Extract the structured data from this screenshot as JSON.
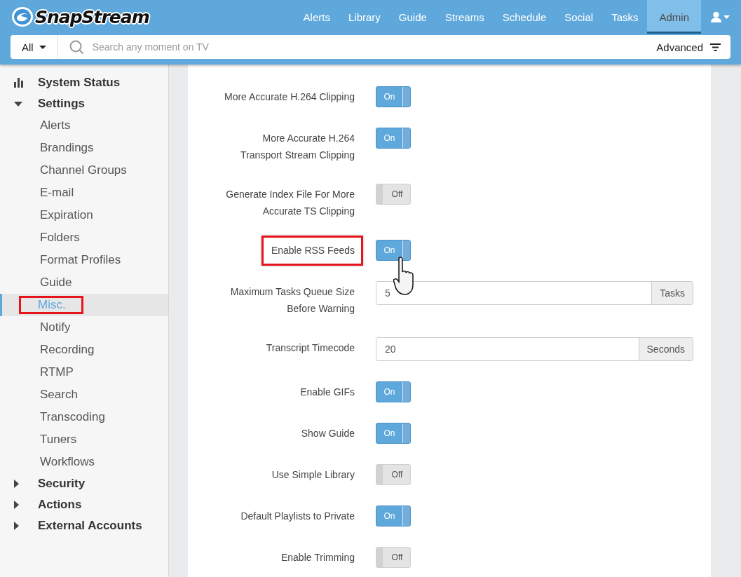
{
  "header": {
    "logo": "SnapStream",
    "nav": [
      {
        "label": "Alerts",
        "selected": false
      },
      {
        "label": "Library",
        "selected": false
      },
      {
        "label": "Guide",
        "selected": false
      },
      {
        "label": "Streams",
        "selected": false
      },
      {
        "label": "Schedule",
        "selected": false
      },
      {
        "label": "Social",
        "selected": false
      },
      {
        "label": "Tasks",
        "selected": false
      },
      {
        "label": "Admin",
        "selected": true
      }
    ]
  },
  "search": {
    "scope": "All",
    "placeholder": "Search any moment on TV",
    "advanced": "Advanced"
  },
  "sidebar": {
    "items": [
      {
        "label": "System Status",
        "kind": "page"
      },
      {
        "label": "Settings",
        "kind": "group",
        "expanded": true,
        "children": [
          {
            "label": "Alerts",
            "selected": false,
            "highlighted": false
          },
          {
            "label": "Brandings",
            "selected": false,
            "highlighted": false
          },
          {
            "label": "Channel Groups",
            "selected": false,
            "highlighted": false
          },
          {
            "label": "E-mail",
            "selected": false,
            "highlighted": false
          },
          {
            "label": "Expiration",
            "selected": false,
            "highlighted": false
          },
          {
            "label": "Folders",
            "selected": false,
            "highlighted": false
          },
          {
            "label": "Format Profiles",
            "selected": false,
            "highlighted": false
          },
          {
            "label": "Guide",
            "selected": false,
            "highlighted": false
          },
          {
            "label": "Misc.",
            "selected": true,
            "highlighted": true
          },
          {
            "label": "Notify",
            "selected": false,
            "highlighted": false
          },
          {
            "label": "Recording",
            "selected": false,
            "highlighted": false
          },
          {
            "label": "RTMP",
            "selected": false,
            "highlighted": false
          },
          {
            "label": "Search",
            "selected": false,
            "highlighted": false
          },
          {
            "label": "Transcoding",
            "selected": false,
            "highlighted": false
          },
          {
            "label": "Tuners",
            "selected": false,
            "highlighted": false
          },
          {
            "label": "Workflows",
            "selected": false,
            "highlighted": false
          }
        ]
      },
      {
        "label": "Security",
        "kind": "group",
        "expanded": false
      },
      {
        "label": "Actions",
        "kind": "group",
        "expanded": false
      },
      {
        "label": "External Accounts",
        "kind": "group",
        "expanded": false
      }
    ]
  },
  "settings": {
    "rows": [
      {
        "kind": "toggle",
        "label": "More Accurate H.264 Clipping",
        "on": true,
        "text": "On",
        "highlighted": false
      },
      {
        "kind": "toggle",
        "label": "More Accurate H.264\nTransport Stream Clipping",
        "on": true,
        "text": "On",
        "highlighted": false
      },
      {
        "kind": "toggle",
        "label": "Generate Index File For More\nAccurate TS Clipping",
        "on": false,
        "text": "Off",
        "highlighted": false
      },
      {
        "kind": "toggle",
        "label": "Enable RSS Feeds",
        "on": true,
        "text": "On",
        "highlighted": true
      },
      {
        "kind": "field",
        "label": "Maximum Tasks Queue Size\nBefore Warning",
        "value": "5",
        "addon": "Tasks",
        "highlighted": false
      },
      {
        "kind": "field",
        "label": "Transcript Timecode",
        "value": "20",
        "addon": "Seconds",
        "highlighted": false
      },
      {
        "kind": "toggle",
        "label": "Enable GIFs",
        "on": true,
        "text": "On",
        "highlighted": false
      },
      {
        "kind": "toggle",
        "label": "Show Guide",
        "on": true,
        "text": "On",
        "highlighted": false
      },
      {
        "kind": "toggle",
        "label": "Use Simple Library",
        "on": false,
        "text": "Off",
        "highlighted": false
      },
      {
        "kind": "toggle",
        "label": "Default Playlists to Private",
        "on": true,
        "text": "On",
        "highlighted": false
      },
      {
        "kind": "toggle",
        "label": "Enable Trimming",
        "on": false,
        "text": "Off",
        "highlighted": false
      }
    ]
  }
}
